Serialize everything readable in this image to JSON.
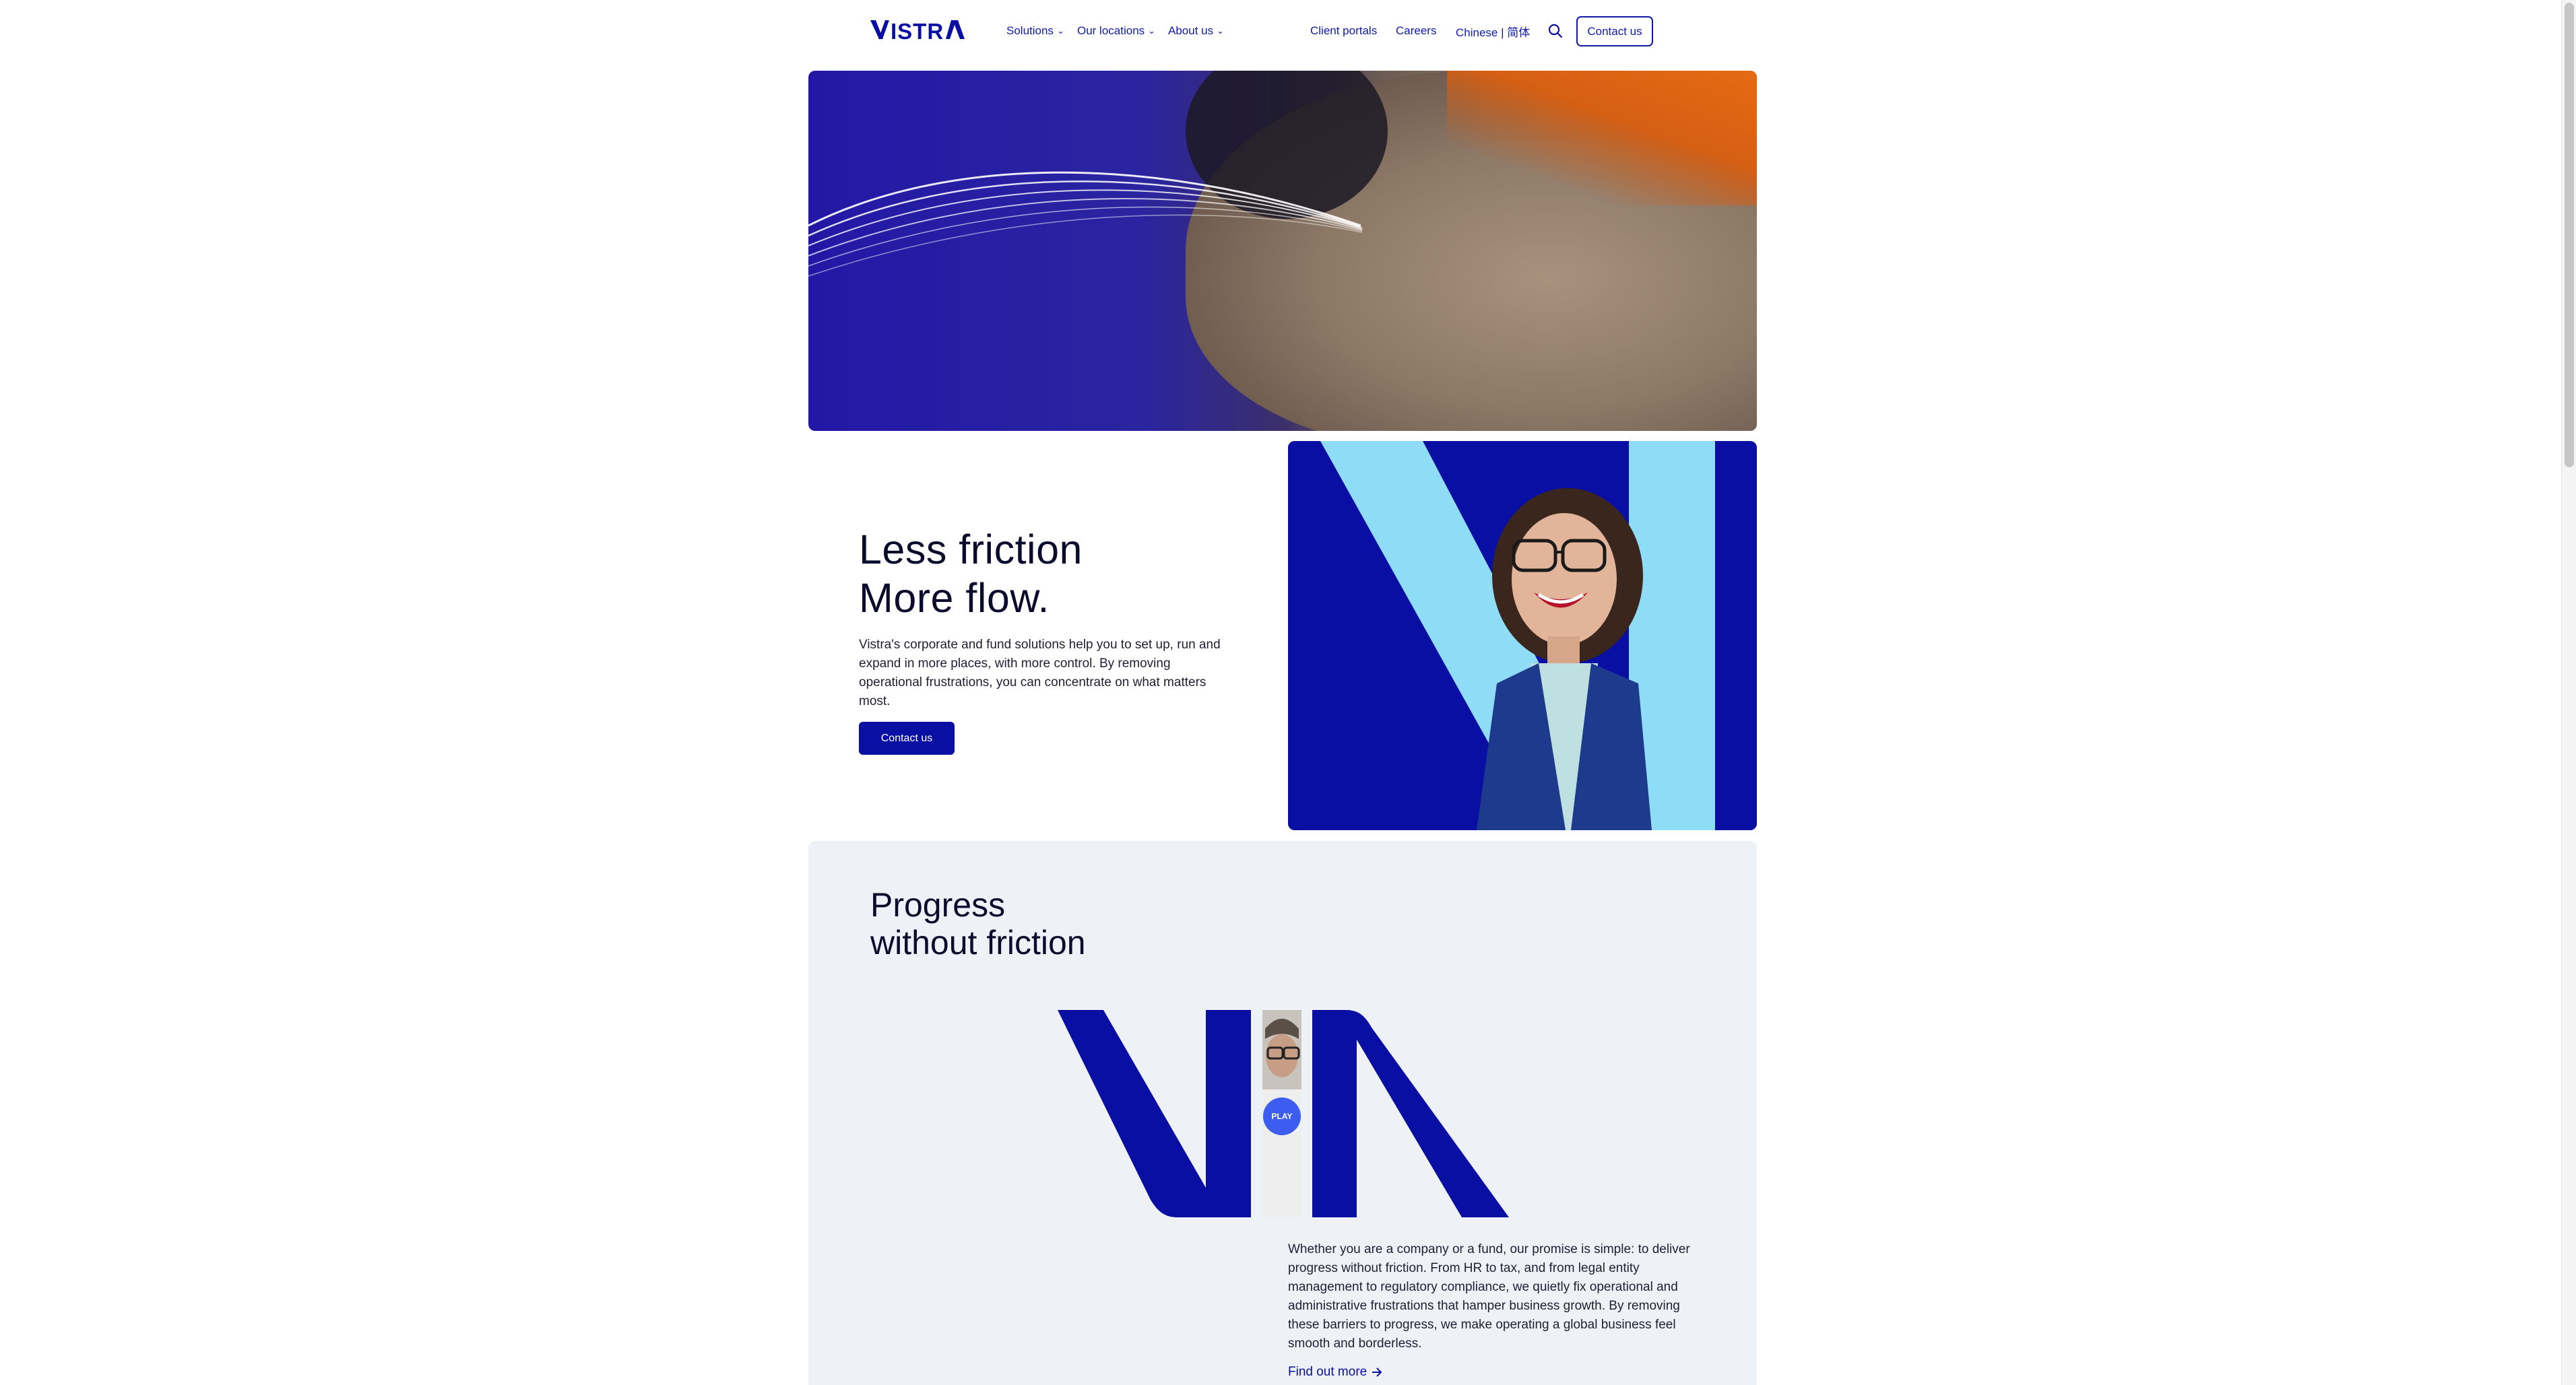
{
  "nav": {
    "logo_text": "VISTRA",
    "primary": [
      {
        "label": "Solutions"
      },
      {
        "label": "Our locations"
      },
      {
        "label": "About us"
      }
    ],
    "secondary": [
      {
        "label": "Client portals"
      },
      {
        "label": "Careers"
      },
      {
        "label": "Chinese | 简体"
      }
    ],
    "contact_label": "Contact us",
    "search_icon": "search-icon"
  },
  "hero_section": {
    "colors": {
      "primary_blue": "#0a0fa3",
      "light_blue": "#8fdcf7",
      "panel_bg": "#eef1f6"
    }
  },
  "intro": {
    "heading_line1": "Less friction",
    "heading_line2": "More flow.",
    "body": "Vistra's corporate and fund solutions help you to set up, run and expand in more places, with more control. By removing operational frustrations, you can concentrate on what matters most.",
    "button_label": "Contact us"
  },
  "progress": {
    "heading_line1": "Progress",
    "heading_line2": "without friction",
    "play_label": "PLAY",
    "body": "Whether you are a company or a fund, our promise is simple: to deliver progress without friction. From HR to tax, and from legal entity management to regulatory compliance, we quietly fix operational and administrative frustrations that hamper business growth. By removing these barriers to progress, we make operating a global business feel smooth and borderless.",
    "link_label": "Find out more"
  }
}
